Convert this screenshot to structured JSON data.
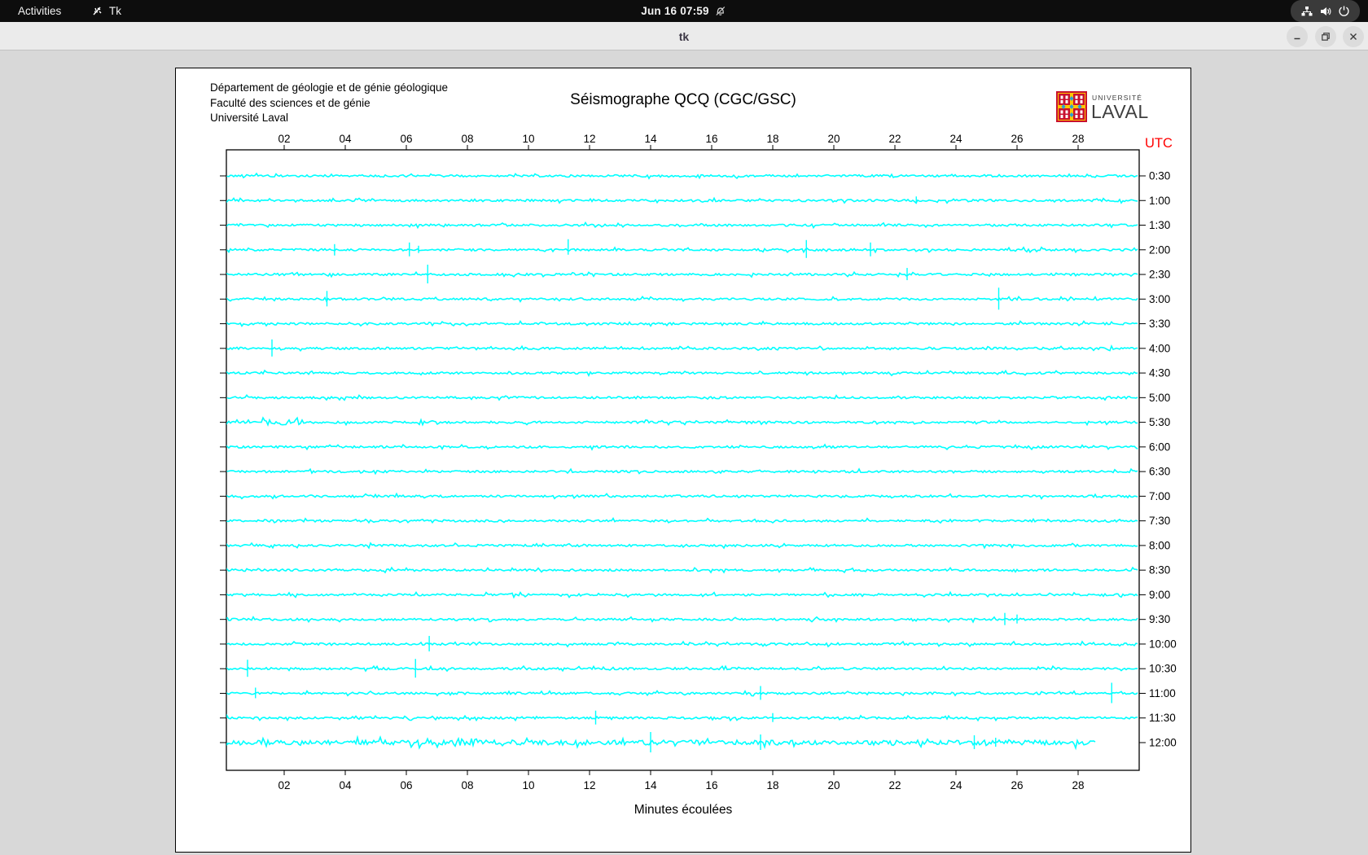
{
  "topbar": {
    "activities_label": "Activities",
    "app_label": "Tk",
    "clock": "Jun 16  07:59",
    "icons": [
      "tk-icon",
      "bell-muted-icon",
      "network-icon",
      "volume-icon",
      "power-icon"
    ]
  },
  "titlebar": {
    "title": "tk",
    "controls": [
      "minimize",
      "maximize",
      "close"
    ]
  },
  "header": {
    "dept_lines": "Département de géologie et de génie géologique\nFaculté des sciences et de génie\nUniversité Laval",
    "title": "Séismographe QCQ (CGC/GSC)"
  },
  "logo": {
    "line1": "UNIVERSITÉ",
    "line2": "LAVAL"
  },
  "chart_data": {
    "type": "line",
    "title": "Séismographe QCQ (CGC/GSC)",
    "xlabel": "Minutes écoulées",
    "right_axis_title": "UTC",
    "right_axis_title_color": "#ff0000",
    "trace_color": "#00ffff",
    "x_range_minutes": [
      0,
      30
    ],
    "x_ticks": [
      "02",
      "04",
      "06",
      "08",
      "10",
      "12",
      "14",
      "16",
      "18",
      "20",
      "22",
      "24",
      "26",
      "28"
    ],
    "grid": false,
    "legend": "none",
    "rows": [
      {
        "utc": "0:30",
        "spikes": []
      },
      {
        "utc": "1:00",
        "spikes": [
          [
            22.7,
            5,
            4
          ]
        ]
      },
      {
        "utc": "1:30",
        "spikes": []
      },
      {
        "utc": "2:00",
        "spikes": [
          [
            3.65,
            7,
            7
          ],
          [
            6.1,
            9,
            8
          ],
          [
            6.4,
            5,
            4
          ],
          [
            11.3,
            13,
            6
          ],
          [
            19.1,
            12,
            10
          ],
          [
            21.2,
            9,
            8
          ]
        ]
      },
      {
        "utc": "2:30",
        "spikes": [
          [
            6.7,
            12,
            11
          ],
          [
            22.4,
            8,
            7
          ]
        ]
      },
      {
        "utc": "3:00",
        "spikes": [
          [
            3.4,
            10,
            9
          ],
          [
            25.4,
            14,
            13
          ]
        ]
      },
      {
        "utc": "3:30",
        "spikes": []
      },
      {
        "utc": "4:00",
        "spikes": [
          [
            1.6,
            11,
            10
          ]
        ]
      },
      {
        "utc": "4:30",
        "spikes": []
      },
      {
        "utc": "5:00",
        "spikes": []
      },
      {
        "utc": "5:30",
        "spikes": [],
        "bursts": [
          [
            1.3,
            2.6,
            2.5
          ]
        ]
      },
      {
        "utc": "6:00",
        "spikes": []
      },
      {
        "utc": "6:30",
        "spikes": []
      },
      {
        "utc": "7:00",
        "spikes": []
      },
      {
        "utc": "7:30",
        "spikes": []
      },
      {
        "utc": "8:00",
        "spikes": []
      },
      {
        "utc": "8:30",
        "spikes": []
      },
      {
        "utc": "9:00",
        "spikes": []
      },
      {
        "utc": "9:30",
        "spikes": [
          [
            25.6,
            8,
            7
          ],
          [
            26.0,
            6,
            5
          ]
        ]
      },
      {
        "utc": "10:00",
        "spikes": [
          [
            6.75,
            10,
            9
          ]
        ]
      },
      {
        "utc": "10:30",
        "spikes": [
          [
            0.8,
            11,
            10
          ],
          [
            6.3,
            12,
            11
          ]
        ]
      },
      {
        "utc": "11:00",
        "spikes": [
          [
            1.06,
            7,
            6
          ],
          [
            17.6,
            9,
            8
          ],
          [
            29.1,
            13,
            12
          ]
        ]
      },
      {
        "utc": "11:30",
        "spikes": [
          [
            12.2,
            9,
            8
          ],
          [
            18.0,
            6,
            5
          ]
        ]
      },
      {
        "utc": "12:00",
        "spikes": [
          [
            14.0,
            13,
            12
          ],
          [
            17.6,
            10,
            9
          ],
          [
            24.6,
            9,
            8
          ],
          [
            25.3,
            6,
            5
          ]
        ],
        "amp": 2.2,
        "end_minute": 28.6,
        "bursts": [
          [
            7.4,
            8.3,
            1.8
          ]
        ]
      }
    ]
  }
}
